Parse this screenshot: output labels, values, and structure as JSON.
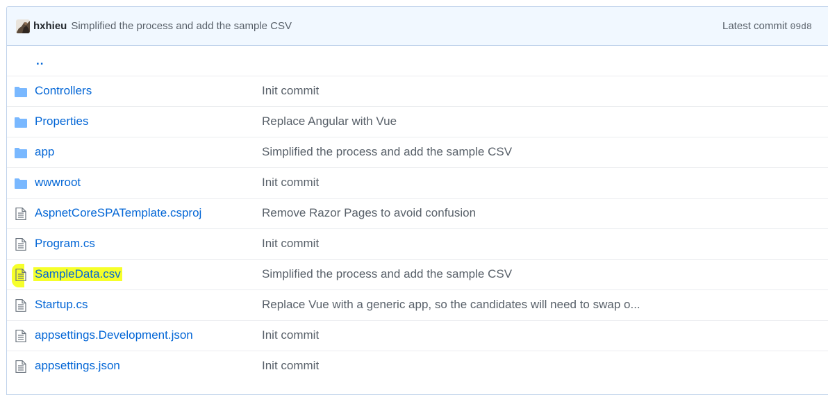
{
  "commit": {
    "author": "hxhieu",
    "message": "Simplified the process and add the sample CSV",
    "latest_label": "Latest commit",
    "sha": "09d8"
  },
  "updir_label": "..",
  "files": [
    {
      "name": "Controllers",
      "type": "folder",
      "message": "Init commit",
      "highlighted": false
    },
    {
      "name": "Properties",
      "type": "folder",
      "message": "Replace Angular with Vue",
      "highlighted": false
    },
    {
      "name": "app",
      "type": "folder",
      "message": "Simplified the process and add the sample CSV",
      "highlighted": false
    },
    {
      "name": "wwwroot",
      "type": "folder",
      "message": "Init commit",
      "highlighted": false
    },
    {
      "name": "AspnetCoreSPATemplate.csproj",
      "type": "file",
      "message": "Remove Razor Pages to avoid confusion",
      "highlighted": false
    },
    {
      "name": "Program.cs",
      "type": "file",
      "message": "Init commit",
      "highlighted": false
    },
    {
      "name": "SampleData.csv",
      "type": "file",
      "message": "Simplified the process and add the sample CSV",
      "highlighted": true
    },
    {
      "name": "Startup.cs",
      "type": "file",
      "message": "Replace Vue with a generic app, so the candidates will need to swap o...",
      "highlighted": false
    },
    {
      "name": "appsettings.Development.json",
      "type": "file",
      "message": "Init commit",
      "highlighted": false
    },
    {
      "name": "appsettings.json",
      "type": "file",
      "message": "Init commit",
      "highlighted": false
    }
  ],
  "colors": {
    "link": "#0366d6",
    "folder_icon": "#79b8ff",
    "file_icon": "#6a737d",
    "highlight": "#f6ff2a"
  }
}
